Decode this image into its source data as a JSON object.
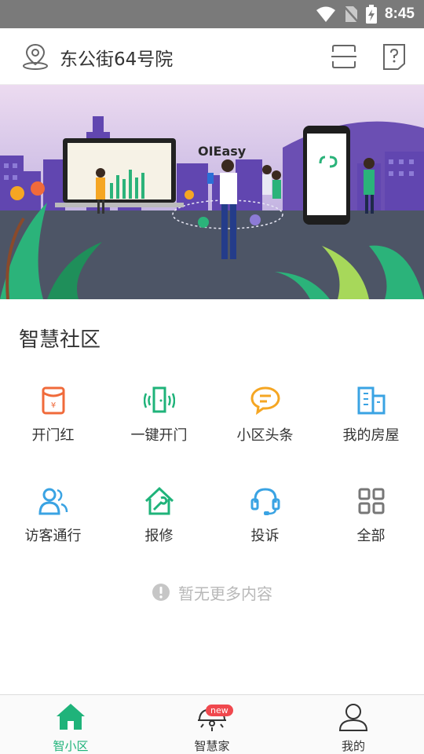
{
  "status_bar": {
    "time": "8:45"
  },
  "header": {
    "address": "东公街64号院"
  },
  "banner": {
    "brand": "OIEasy"
  },
  "section": {
    "title": "智慧社区"
  },
  "grid": [
    {
      "label": "开门红",
      "icon": "red-envelope-icon",
      "color": "#f06a3a"
    },
    {
      "label": "一键开门",
      "icon": "door-signal-icon",
      "color": "#1fb37a"
    },
    {
      "label": "小区头条",
      "icon": "chat-bubble-icon",
      "color": "#f5a623"
    },
    {
      "label": "我的房屋",
      "icon": "building-icon",
      "color": "#3aa3e3"
    },
    {
      "label": "访客通行",
      "icon": "visitors-icon",
      "color": "#3aa3e3"
    },
    {
      "label": "报修",
      "icon": "house-wrench-icon",
      "color": "#1fb37a"
    },
    {
      "label": "投诉",
      "icon": "headset-icon",
      "color": "#3aa3e3"
    },
    {
      "label": "全部",
      "icon": "grid-icon",
      "color": "#777777"
    }
  ],
  "footer_note": {
    "text": "暂无更多内容"
  },
  "tabs": [
    {
      "label": "智小区",
      "icon": "home-icon",
      "active": true
    },
    {
      "label": "智慧家",
      "icon": "smart-light-icon",
      "badge": "new"
    },
    {
      "label": "我的",
      "icon": "person-icon"
    }
  ],
  "colors": {
    "accent": "#1fb37a",
    "badge": "#f0484e",
    "muted": "#b8b8b8"
  }
}
